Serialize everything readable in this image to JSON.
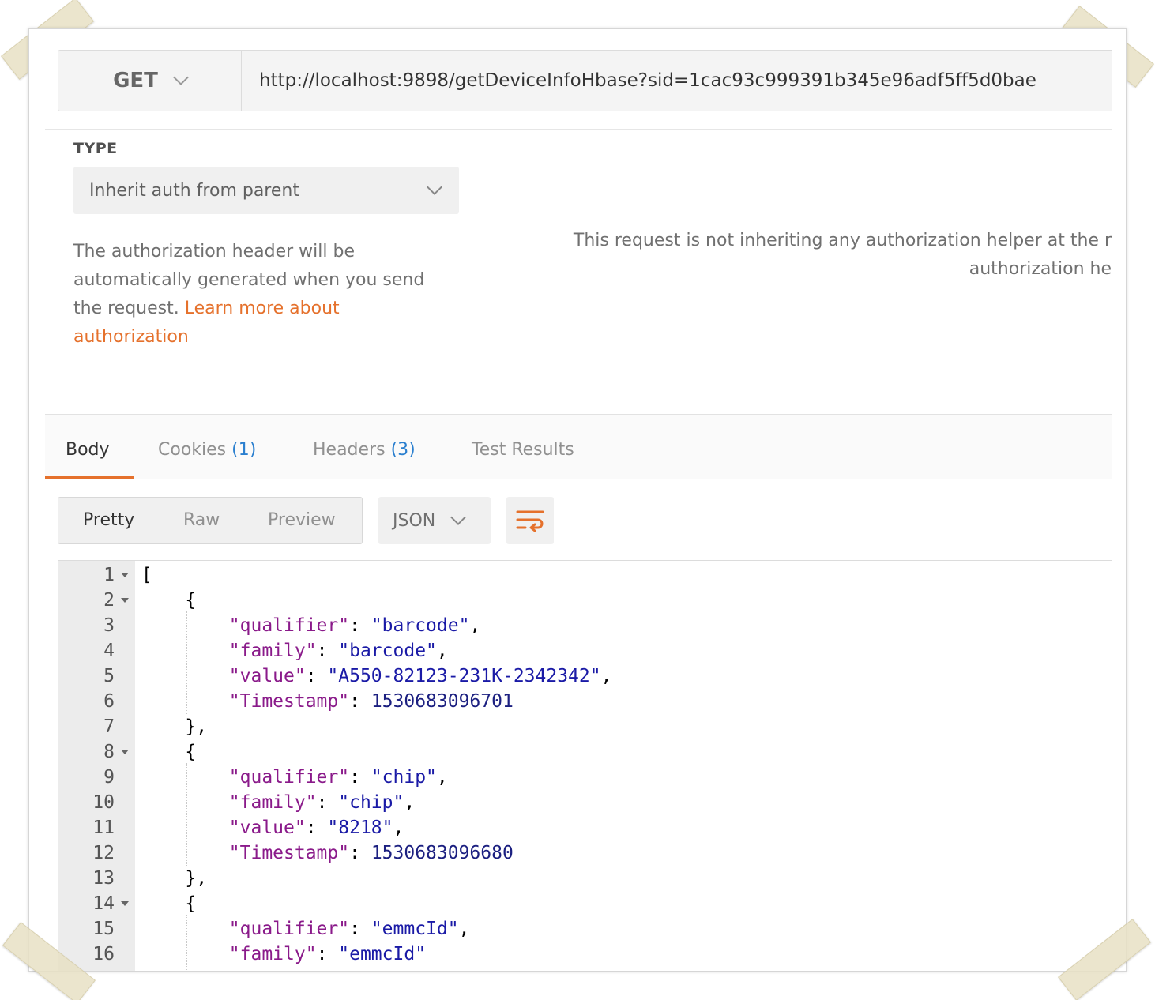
{
  "request": {
    "method": "GET",
    "url": "http://localhost:9898/getDeviceInfoHbase?sid=1cac93c999391b345e96adf5ff5d0bae"
  },
  "auth": {
    "type_label": "TYPE",
    "type_value": "Inherit auth from parent",
    "description": "The authorization header will be automatically generated when you send the request. ",
    "link_text": "Learn more about authorization",
    "info_line1": "This request is not inheriting any authorization helper at the r",
    "info_line2": "authorization he"
  },
  "response_tabs": {
    "body": "Body",
    "cookies": "Cookies",
    "cookies_count": "(1)",
    "headers": "Headers",
    "headers_count": "(3)",
    "tests": "Test Results"
  },
  "toolbar": {
    "pretty": "Pretty",
    "raw": "Raw",
    "preview": "Preview",
    "format": "JSON",
    "wrap_icon": "wrap-lines-icon"
  },
  "colors": {
    "accent": "#e5712c",
    "count_blue": "#2a7fcf",
    "json_key": "#8a1a8a",
    "json_string": "#1a1aa6",
    "json_number": "#1b1f80"
  },
  "code": {
    "line_numbers": [
      "1",
      "2",
      "3",
      "4",
      "5",
      "6",
      "7",
      "8",
      "9",
      "10",
      "11",
      "12",
      "13",
      "14",
      "15",
      "16"
    ],
    "lines": [
      [
        {
          "t": "[",
          "c": "p"
        }
      ],
      [
        {
          "t": "    {",
          "c": "p"
        }
      ],
      [
        {
          "t": "        ",
          "c": "p"
        },
        {
          "t": "\"qualifier\"",
          "c": "k"
        },
        {
          "t": ": ",
          "c": "p"
        },
        {
          "t": "\"barcode\"",
          "c": "s"
        },
        {
          "t": ",",
          "c": "p"
        }
      ],
      [
        {
          "t": "        ",
          "c": "p"
        },
        {
          "t": "\"family\"",
          "c": "k"
        },
        {
          "t": ": ",
          "c": "p"
        },
        {
          "t": "\"barcode\"",
          "c": "s"
        },
        {
          "t": ",",
          "c": "p"
        }
      ],
      [
        {
          "t": "        ",
          "c": "p"
        },
        {
          "t": "\"value\"",
          "c": "k"
        },
        {
          "t": ": ",
          "c": "p"
        },
        {
          "t": "\"A550-82123-231K-2342342\"",
          "c": "s"
        },
        {
          "t": ",",
          "c": "p"
        }
      ],
      [
        {
          "t": "        ",
          "c": "p"
        },
        {
          "t": "\"Timestamp\"",
          "c": "k"
        },
        {
          "t": ": ",
          "c": "p"
        },
        {
          "t": "1530683096701",
          "c": "n"
        }
      ],
      [
        {
          "t": "    },",
          "c": "p"
        }
      ],
      [
        {
          "t": "    {",
          "c": "p"
        }
      ],
      [
        {
          "t": "        ",
          "c": "p"
        },
        {
          "t": "\"qualifier\"",
          "c": "k"
        },
        {
          "t": ": ",
          "c": "p"
        },
        {
          "t": "\"chip\"",
          "c": "s"
        },
        {
          "t": ",",
          "c": "p"
        }
      ],
      [
        {
          "t": "        ",
          "c": "p"
        },
        {
          "t": "\"family\"",
          "c": "k"
        },
        {
          "t": ": ",
          "c": "p"
        },
        {
          "t": "\"chip\"",
          "c": "s"
        },
        {
          "t": ",",
          "c": "p"
        }
      ],
      [
        {
          "t": "        ",
          "c": "p"
        },
        {
          "t": "\"value\"",
          "c": "k"
        },
        {
          "t": ": ",
          "c": "p"
        },
        {
          "t": "\"8218\"",
          "c": "s"
        },
        {
          "t": ",",
          "c": "p"
        }
      ],
      [
        {
          "t": "        ",
          "c": "p"
        },
        {
          "t": "\"Timestamp\"",
          "c": "k"
        },
        {
          "t": ": ",
          "c": "p"
        },
        {
          "t": "1530683096680",
          "c": "n"
        }
      ],
      [
        {
          "t": "    },",
          "c": "p"
        }
      ],
      [
        {
          "t": "    {",
          "c": "p"
        }
      ],
      [
        {
          "t": "        ",
          "c": "p"
        },
        {
          "t": "\"qualifier\"",
          "c": "k"
        },
        {
          "t": ": ",
          "c": "p"
        },
        {
          "t": "\"emmcId\"",
          "c": "s"
        },
        {
          "t": ",",
          "c": "p"
        }
      ],
      [
        {
          "t": "        ",
          "c": "p"
        },
        {
          "t": "\"family\"",
          "c": "k"
        },
        {
          "t": ": ",
          "c": "p"
        },
        {
          "t": "\"emmcId\"",
          "c": "s"
        }
      ]
    ],
    "fold_lines": [
      "1",
      "2",
      "8",
      "14"
    ]
  }
}
